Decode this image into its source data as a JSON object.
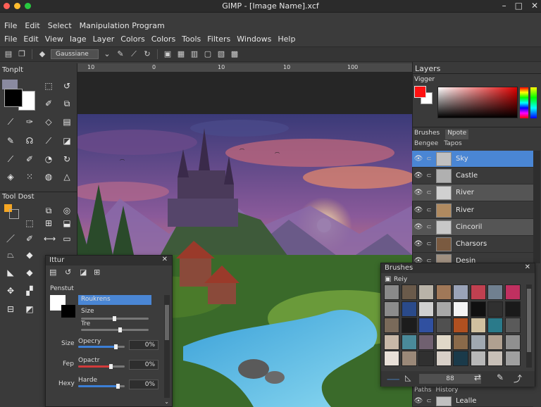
{
  "window": {
    "title": "GIMP - [Image Name].xcf",
    "controls": [
      "–",
      "□",
      "✕"
    ]
  },
  "menubar_top": [
    "File",
    "Edit",
    "Select",
    "Manipulation Program"
  ],
  "menubar": [
    "File",
    "Edit",
    "View",
    "Iage",
    "Layer",
    "Colors",
    "Colors",
    "Tools",
    "Filters",
    "Windows",
    "Help"
  ],
  "toolbar": {
    "mode_select": "Gaussiane"
  },
  "toolbox": {
    "header": "Tonplt",
    "sub_header": "Tool Dost"
  },
  "ruler": {
    "ticks": [
      "10",
      "0",
      "10",
      "10",
      "100"
    ]
  },
  "layers": {
    "header": "Layers",
    "sub": "Vigger",
    "tabs": [
      "Brushes",
      "Npote"
    ],
    "subtabs": [
      "Bengee",
      "Tapos"
    ],
    "items": [
      {
        "name": "Sky",
        "selected": true
      },
      {
        "name": "Castle",
        "selected": false
      },
      {
        "name": "River",
        "selected": false
      },
      {
        "name": "River",
        "selected": false
      },
      {
        "name": "Cincoril",
        "selected": false
      },
      {
        "name": "Charsors",
        "selected": false
      },
      {
        "name": "Desin",
        "selected": false
      }
    ],
    "bottom_tabs": [
      "Paths",
      "History"
    ],
    "bottom_item": "Lealle"
  },
  "tool_options": {
    "title": "Ittur",
    "section": "Penstut",
    "mode_value": "Roukrens",
    "size_label": "Size",
    "tre_label": "Tre",
    "rows": [
      {
        "label": "Size",
        "name": "Opecry",
        "value": "0%",
        "fill": 0.8,
        "color": "#3c7fd6"
      },
      {
        "label": "Fep",
        "name": "Opactr",
        "value": "0%",
        "fill": 0.7,
        "color": "#d23b3b"
      },
      {
        "label": "Hexy",
        "name": "Harde",
        "value": "0%",
        "fill": 0.85,
        "color": "#3c7fd6"
      }
    ]
  },
  "brushes": {
    "title": "Brushes",
    "filter": "Reiy",
    "count": "88",
    "tile_colors": [
      "#8a8a8a",
      "#6a5a4a",
      "#b9b3a8",
      "#a07858",
      "#9aa3b8",
      "#c04050",
      "#708090",
      "#c03060",
      "#8c8c8c",
      "#2a4a8a",
      "#d0d0d0",
      "#a8a8a8",
      "#f4f4f4",
      "#101010",
      "#303030",
      "#1a1a1a",
      "#7a6a5a",
      "#1c1c1c",
      "#3050a0",
      "#505050",
      "#b05020",
      "#d0c0a0",
      "#2a7a8a",
      "#5a5a5a",
      "#c8b8a8",
      "#4a8a9a",
      "#706070",
      "#e0d8c8",
      "#8a6a4a",
      "#a0a8b0",
      "#b0a090",
      "#909090",
      "#e8e0d8",
      "#9a8878",
      "#303030",
      "#d8d0c8",
      "#1a3a4a",
      "#b8b8b8",
      "#c8c0b8",
      "#a0a0a0"
    ]
  },
  "colors": {
    "fg": "#000000",
    "bg": "#ffffff",
    "accent": "#4a90d9"
  }
}
